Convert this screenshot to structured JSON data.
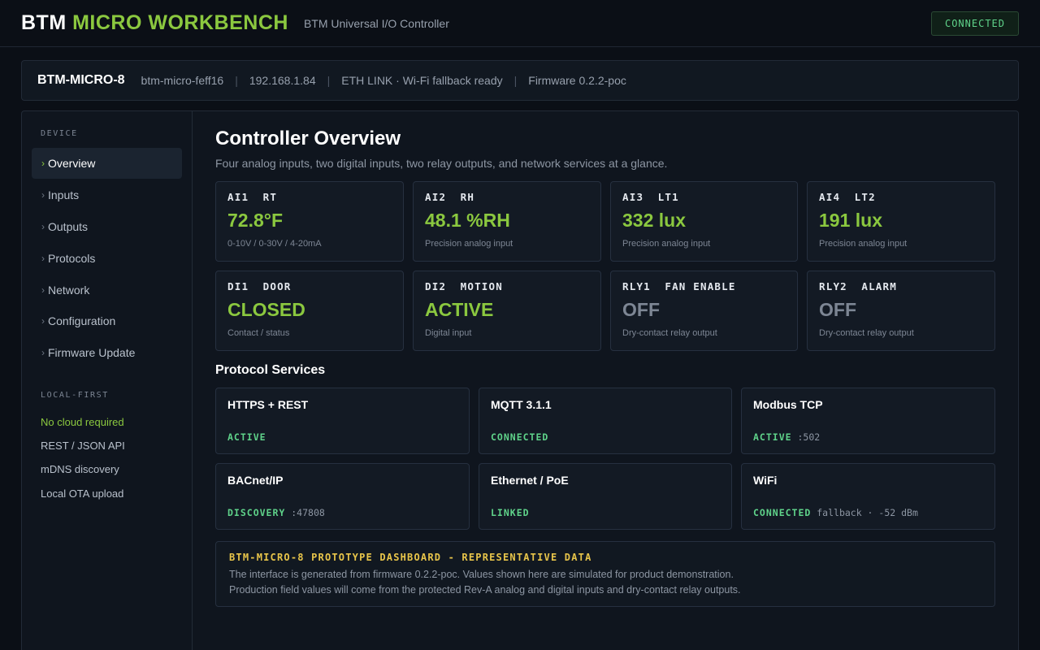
{
  "header": {
    "brand_primary": "BTM",
    "brand_accent": "MICRO WORKBENCH",
    "subtitle": "BTM Universal I/O Controller",
    "status": "CONNECTED"
  },
  "device": {
    "name": "BTM-MICRO-8",
    "hostname": "btm-micro-feff16",
    "ip": "192.168.1.84",
    "link": "ETH LINK · Wi-Fi fallback ready",
    "firmware": "Firmware 0.2.2-poc",
    "separator": "|"
  },
  "sidebar": {
    "device_heading": "DEVICE",
    "nav": [
      {
        "label": "Overview",
        "active": true
      },
      {
        "label": "Inputs"
      },
      {
        "label": "Outputs"
      },
      {
        "label": "Protocols"
      },
      {
        "label": "Network"
      },
      {
        "label": "Configuration"
      },
      {
        "label": "Firmware Update"
      }
    ],
    "chevron": "›",
    "local_heading": "LOCAL-FIRST",
    "features": [
      "No cloud required",
      "REST / JSON API",
      "mDNS discovery",
      "Local OTA upload"
    ]
  },
  "main": {
    "title": "Controller Overview",
    "description": "Four analog inputs, two digital inputs, two relay outputs, and network services at a glance."
  },
  "io_cards": [
    {
      "label": "AI1  RT",
      "value": "72.8°F",
      "sub": "0-10V / 0-30V / 4-20mA"
    },
    {
      "label": "AI2  RH",
      "value": "48.1 %RH",
      "sub": "Precision analog input"
    },
    {
      "label": "AI3  LT1",
      "value": "332 lux",
      "sub": "Precision analog input"
    },
    {
      "label": "AI4  LT2",
      "value": "191 lux",
      "sub": "Precision analog input"
    },
    {
      "label": "DI1  DOOR",
      "value": "CLOSED",
      "sub": "Contact / status"
    },
    {
      "label": "DI2  MOTION",
      "value": "ACTIVE",
      "sub": "Digital input"
    },
    {
      "label": "RLY1  FAN ENABLE",
      "value": "OFF",
      "sub": "Dry-contact relay output"
    },
    {
      "label": "RLY2  ALARM",
      "value": "OFF",
      "sub": "Dry-contact relay output"
    }
  ],
  "protocols": {
    "title": "Protocol Services",
    "services": [
      {
        "name": "HTTPS + REST",
        "status": "ACTIVE",
        "detail": ""
      },
      {
        "name": "MQTT 3.1.1",
        "status": "CONNECTED",
        "detail": ""
      },
      {
        "name": "Modbus TCP",
        "status": "ACTIVE",
        "detail": ":502"
      },
      {
        "name": "BACnet/IP",
        "status": "DISCOVERY",
        "detail": ":47808"
      },
      {
        "name": "Ethernet / PoE",
        "status": "LINKED",
        "detail": ""
      },
      {
        "name": "WiFi",
        "status": "CONNECTED",
        "detail": "fallback · -52 dBm"
      }
    ]
  },
  "notice": {
    "title": "BTM-MICRO-8 PROTOTYPE DASHBOARD - REPRESENTATIVE DATA",
    "line1": "The interface is generated from firmware 0.2.2-poc. Values shown here are simulated for product demonstration.",
    "line2": "Production field values will come from the protected Rev-A analog and digital inputs and dry-contact relay outputs."
  },
  "colors": {
    "accent": "#8bc83f",
    "status_green": "#5fd38a",
    "warning": "#e8c54a",
    "background": "#0b0f16"
  }
}
